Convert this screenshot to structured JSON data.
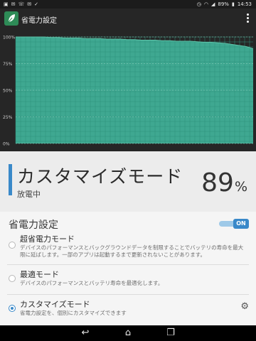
{
  "status_bar": {
    "left_icons": [
      "sms-icon",
      "mail-icon",
      "missed-call-icon",
      "mail-icon",
      "check-icon"
    ],
    "battery": "89%",
    "time": "14:53"
  },
  "app_bar": {
    "title": "省電力設定"
  },
  "chart_data": {
    "type": "area",
    "x": [
      0,
      1,
      2,
      3,
      4,
      5,
      6,
      7,
      8,
      9,
      10,
      11,
      12,
      13,
      14,
      15,
      16,
      17,
      18,
      19,
      20,
      21,
      22,
      23,
      24,
      25,
      26,
      27,
      28,
      29,
      30,
      31,
      32,
      33,
      34
    ],
    "values": [
      100,
      100,
      100,
      100,
      100,
      99.5,
      99.5,
      99,
      99,
      99,
      98.5,
      98.5,
      98.5,
      98,
      98,
      98,
      97.5,
      97.5,
      97,
      97,
      97,
      96.5,
      96.5,
      96,
      96,
      96,
      95.5,
      95,
      95,
      94.5,
      94,
      93,
      92,
      91,
      89
    ],
    "yticks": [
      "100%",
      "75%",
      "50%",
      "25%",
      "0%"
    ],
    "ylim": [
      0,
      100
    ],
    "grid": true,
    "fill_color": "#3fa891",
    "grid_color": "#2f8f7b"
  },
  "summary": {
    "mode_title": "カスタマイズモード",
    "charge_status": "放電中",
    "percent_value": "89",
    "percent_unit": "%"
  },
  "settings": {
    "header": "省電力設定",
    "toggle_label": "ON",
    "toggle_on": true,
    "options": [
      {
        "title": "超省電力モード",
        "description": "デバイスのパフォーマンスとバックグラウンドデータを制限することでバッテリの寿命を最大限に延ばします。一部のアプリは起動するまで更新されないことがあります。",
        "selected": false
      },
      {
        "title": "最適モード",
        "description": "デバイスのパフォーマンスとバッテリ寿命を最適化します。",
        "selected": false
      },
      {
        "title": "カスタマイズモード",
        "description": "省電力設定を、個別にカスタマイズできます",
        "selected": true
      }
    ]
  },
  "nav_bar": {
    "back_icon": "↩",
    "home_icon": "⌂",
    "recents_icon": "❐"
  },
  "colors": {
    "accent": "#3a89c9",
    "chart_fill": "#3fa891",
    "toolbar_bg": "#262626"
  }
}
